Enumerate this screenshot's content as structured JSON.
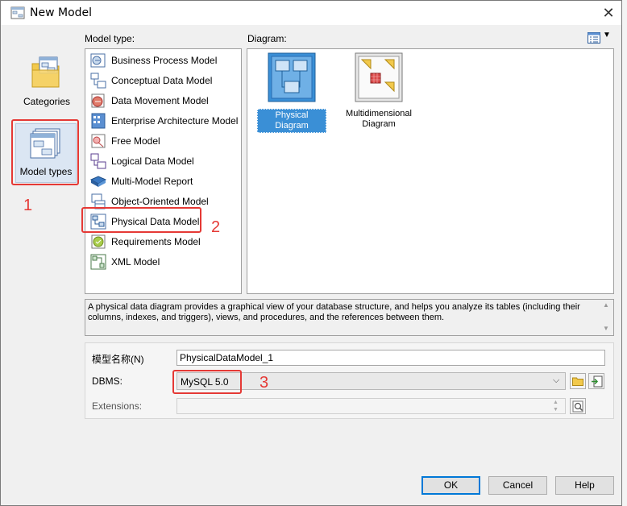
{
  "window": {
    "title": "New Model",
    "close_glyph": "✕"
  },
  "left_nav": {
    "categories_label": "Categories",
    "model_types_label": "Model types"
  },
  "model_type": {
    "header": "Model type:",
    "items": [
      {
        "label": "Business Process Model",
        "icon": "business-process-icon"
      },
      {
        "label": "Conceptual Data Model",
        "icon": "conceptual-data-icon"
      },
      {
        "label": "Data Movement Model",
        "icon": "data-movement-icon"
      },
      {
        "label": "Enterprise Architecture Model",
        "icon": "enterprise-architecture-icon"
      },
      {
        "label": "Free Model",
        "icon": "free-model-icon"
      },
      {
        "label": "Logical Data Model",
        "icon": "logical-data-icon"
      },
      {
        "label": "Multi-Model Report",
        "icon": "multi-model-report-icon"
      },
      {
        "label": "Object-Oriented Model",
        "icon": "object-oriented-icon"
      },
      {
        "label": "Physical Data Model",
        "icon": "physical-data-icon"
      },
      {
        "label": "Requirements Model",
        "icon": "requirements-icon"
      },
      {
        "label": "XML Model",
        "icon": "xml-model-icon"
      }
    ]
  },
  "diagram": {
    "header": "Diagram:",
    "items": [
      {
        "label": "Physical Diagram",
        "selected": true
      },
      {
        "label": "Multidimensional Diagram",
        "selected": false
      }
    ]
  },
  "description": "A physical data diagram provides a graphical view of your database structure, and helps you analyze its tables (including their columns, indexes, and triggers), views, and procedures, and the references between them.",
  "form": {
    "name_label": "模型名称(N)",
    "name_value": "PhysicalDataModel_1",
    "dbms_label": "DBMS:",
    "dbms_value": "MySQL 5.0",
    "extensions_label": "Extensions:",
    "extensions_value": ""
  },
  "buttons": {
    "ok": "OK",
    "cancel": "Cancel",
    "help": "Help"
  },
  "annotations": {
    "n1": "1",
    "n2": "2",
    "n3": "3"
  },
  "colors": {
    "selection": "#3a8fd6",
    "annotation": "#e53935",
    "default_button": "#0078d7"
  }
}
